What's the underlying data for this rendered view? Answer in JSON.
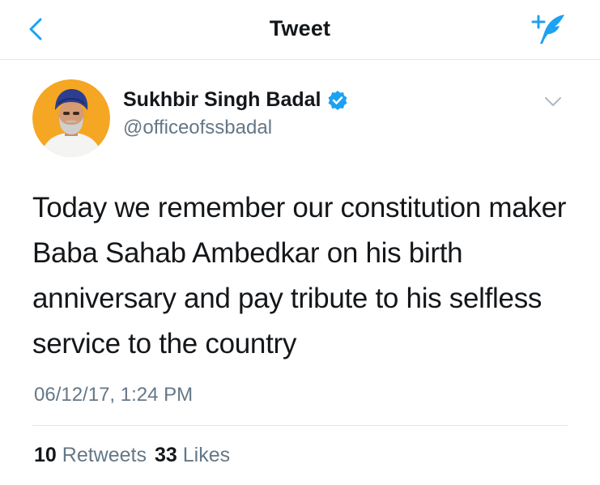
{
  "header": {
    "title": "Tweet",
    "back_icon": "chevron-left-icon",
    "compose_icon": "compose-tweet-icon"
  },
  "tweet": {
    "display_name": "Sukhbir Singh Badal",
    "handle": "@officeofssbadal",
    "verified": true,
    "text": "Today we remember our constitution maker Baba Sahab Ambedkar on his birth anniversary and pay tribute to his selfless service to the country",
    "timestamp": "06/12/17, 1:24 PM",
    "retweets_count": "10",
    "retweets_label": "Retweets",
    "likes_count": "33",
    "likes_label": "Likes"
  },
  "colors": {
    "accent": "#1da1f2",
    "text_primary": "#14171a",
    "text_secondary": "#657786",
    "divider": "#e1e8ed",
    "avatar_bg": "#f5a623"
  }
}
